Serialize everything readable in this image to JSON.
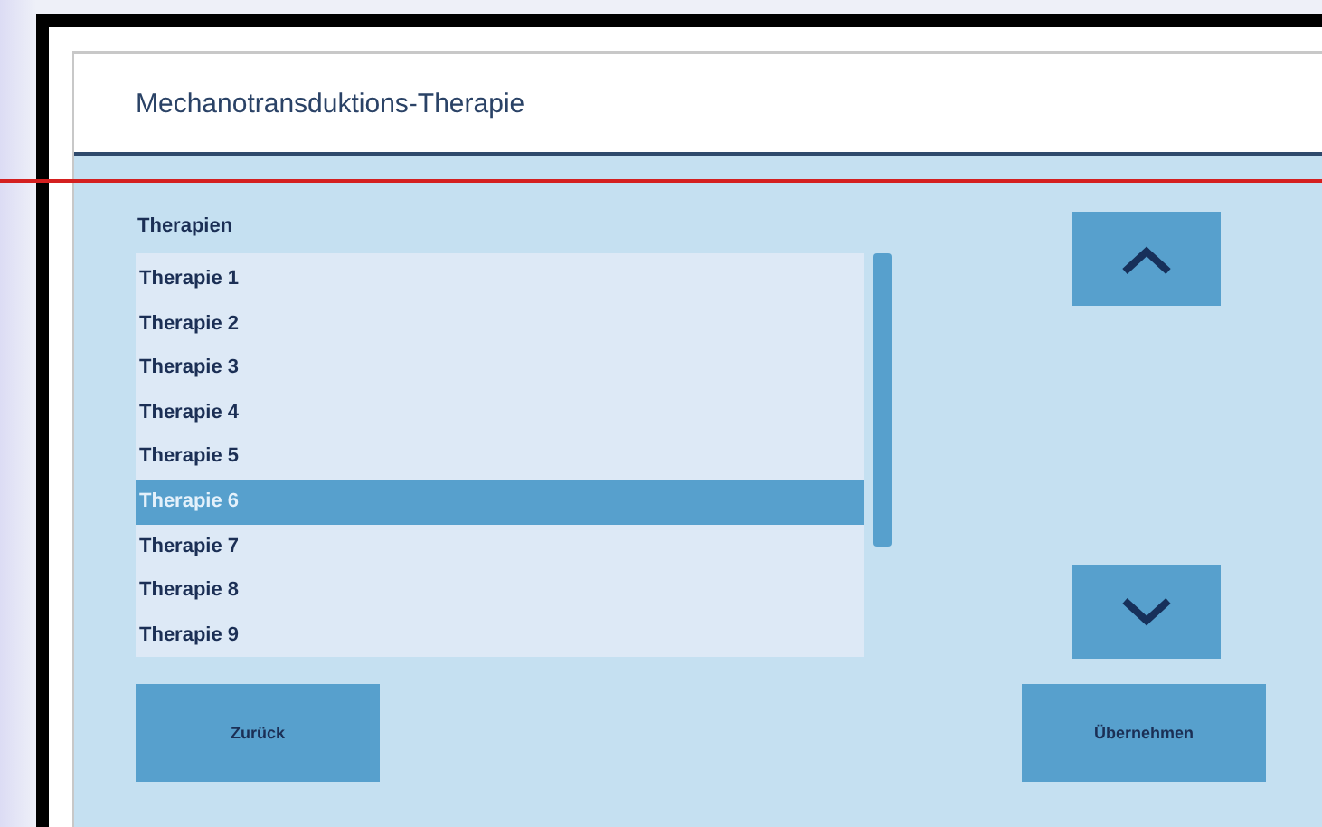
{
  "window": {
    "title": "Mechanotransduktions-Therapie"
  },
  "list": {
    "label": "Therapien",
    "items": [
      {
        "label": "Therapie 1",
        "selected": false
      },
      {
        "label": "Therapie 2",
        "selected": false
      },
      {
        "label": "Therapie 3",
        "selected": false
      },
      {
        "label": "Therapie 4",
        "selected": false
      },
      {
        "label": "Therapie 5",
        "selected": false
      },
      {
        "label": "Therapie 6",
        "selected": true
      },
      {
        "label": "Therapie 7",
        "selected": false
      },
      {
        "label": "Therapie 8",
        "selected": false
      },
      {
        "label": "Therapie 9",
        "selected": false
      }
    ]
  },
  "buttons": [
    {
      "label": "Zurück"
    },
    {
      "label": "Übernehmen"
    }
  ]
}
